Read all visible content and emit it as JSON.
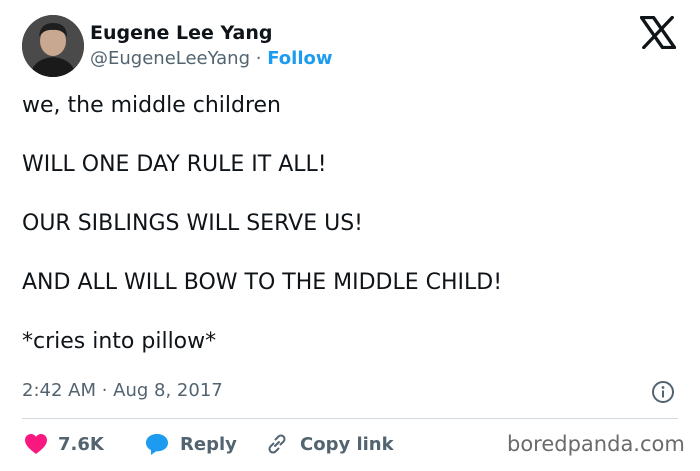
{
  "author": {
    "name": "Eugene Lee Yang",
    "handle": "@EugeneLeeYang",
    "separator": "·",
    "follow_label": "Follow"
  },
  "tweet": {
    "lines": [
      "we, the middle children",
      "WILL ONE DAY RULE IT ALL!",
      "OUR SIBLINGS WILL SERVE US!",
      "AND ALL WILL BOW TO THE MIDDLE CHILD!",
      "*cries into pillow*"
    ]
  },
  "meta": {
    "timestamp": "2:42 AM · Aug 8, 2017"
  },
  "actions": {
    "like_count": "7.6K",
    "reply_label": "Reply",
    "copy_label": "Copy link"
  },
  "watermark": "boredpanda.com",
  "colors": {
    "accent": "#1d9bf0",
    "like": "#f91880",
    "text": "#0f1419",
    "muted": "#536471",
    "divider": "#cfd9de"
  },
  "icons": [
    "x-logo-icon",
    "info-icon",
    "heart-icon",
    "reply-bubble-icon",
    "link-icon"
  ]
}
